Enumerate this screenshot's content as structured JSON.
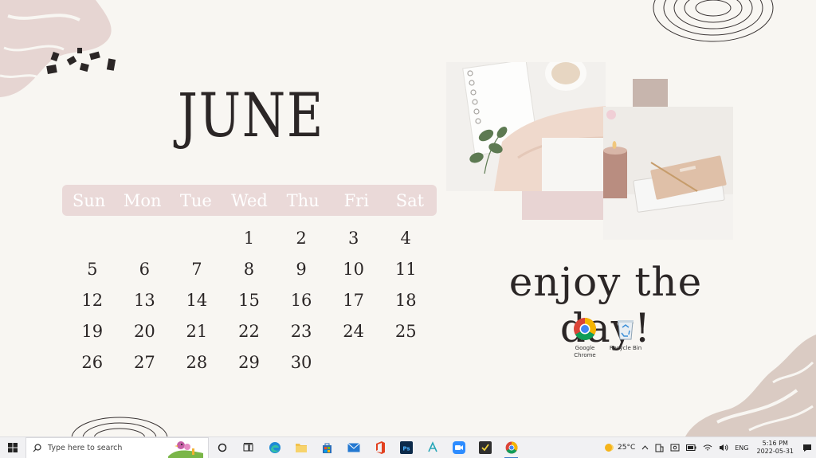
{
  "calendar": {
    "month": "JUNE",
    "weekdays": [
      "Sun",
      "Mon",
      "Tue",
      "Wed",
      "Thu",
      "Fri",
      "Sat"
    ],
    "days": [
      "",
      "",
      "",
      "1",
      "2",
      "3",
      "4",
      "5",
      "6",
      "7",
      "8",
      "9",
      "10",
      "11",
      "12",
      "13",
      "14",
      "15",
      "16",
      "17",
      "18",
      "19",
      "20",
      "21",
      "22",
      "23",
      "24",
      "25",
      "26",
      "27",
      "28",
      "29",
      "30",
      "",
      ""
    ]
  },
  "slogan": "enjoy the day!",
  "desktop_icons": [
    {
      "label": "Google Chrome",
      "icon": "chrome-icon"
    },
    {
      "label": "Recycle Bin",
      "icon": "recycle-bin-icon"
    }
  ],
  "taskbar": {
    "search_placeholder": "Type here to search",
    "apps": [
      "cortana-icon",
      "task-view-icon",
      "edge-icon",
      "file-explorer-icon",
      "store-icon",
      "mail-icon",
      "office-icon",
      "photoshop-icon",
      "app-icon",
      "zoom-icon",
      "notes-icon",
      "chrome-icon"
    ],
    "weather_temp": "25°C",
    "language": "ENG",
    "time": "5:16 PM",
    "date": "2022-05-31"
  },
  "colors": {
    "background": "#f8f6f2",
    "weekday_bar": "#ead9d8",
    "text": "#2b2626",
    "accent_mauve": "#c7b5ad"
  }
}
